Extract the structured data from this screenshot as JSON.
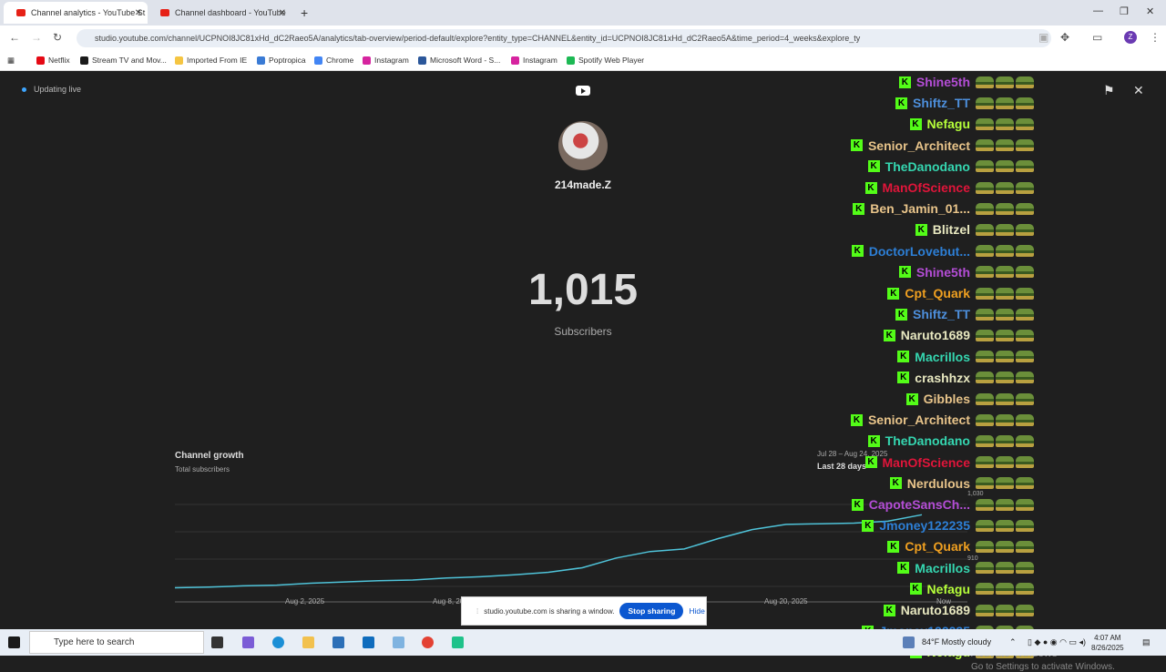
{
  "browser": {
    "tabs": [
      {
        "label": "Channel analytics - YouTube St"
      },
      {
        "label": "Channel dashboard - YouTube"
      }
    ],
    "url": "studio.youtube.com/channel/UCPNOI8JC81xHd_dC2Raeo5A/analytics/tab-overview/period-default/explore?entity_type=CHANNEL&entity_id=UCPNOI8JC81xHd_dC2Raeo5A&time_period=4_weeks&explore_ty",
    "profile_initial": "Z",
    "bookmarks": [
      {
        "label": "Netflix",
        "color": "#e50914"
      },
      {
        "label": "Stream TV and Mov...",
        "color": "#1a1a1a"
      },
      {
        "label": "Imported From IE",
        "color": "#f5c542"
      },
      {
        "label": "Poptropica",
        "color": "#3a7bd5"
      },
      {
        "label": "Chrome",
        "color": "#4285f4"
      },
      {
        "label": "Instagram",
        "color": "#d6249f"
      },
      {
        "label": "Microsoft Word - S...",
        "color": "#2b579a"
      },
      {
        "label": "Instagram",
        "color": "#d6249f"
      },
      {
        "label": "Spotify Web Player",
        "color": "#1db954"
      }
    ]
  },
  "stage": {
    "live_label": "Updating live",
    "channel_name": "214made.Z",
    "subscriber_count": "1,015",
    "subscriber_label": "Subscribers",
    "growth_title": "Channel growth",
    "growth_subtitle": "Total subscribers",
    "range_dates": "Jul 28 – Aug 24, 2025",
    "range_label": "Last 28 days"
  },
  "chart_data": {
    "type": "line",
    "x_tick_labels": [
      "Aug 2, 2025",
      "Aug 8, 2025",
      "Aug 20, 2025",
      "Now"
    ],
    "y_labels": [
      "1,030",
      "910"
    ],
    "values": [
      902,
      903,
      905,
      906,
      909,
      911,
      913,
      914,
      917,
      919,
      922,
      926,
      933,
      948,
      958,
      962,
      978,
      992,
      1000,
      1001,
      1002,
      1005,
      1015
    ]
  },
  "chat": {
    "rows": [
      {
        "name": "Shine5th",
        "color": "#b44dd6"
      },
      {
        "name": "Shiftz_TT",
        "color": "#4d8fdc"
      },
      {
        "name": "Nefagu",
        "color": "#b6ff3a"
      },
      {
        "name": "Senior_Architect",
        "color": "#e8c48a"
      },
      {
        "name": "TheDanodano",
        "color": "#35d6b0"
      },
      {
        "name": "ManOfScience",
        "color": "#e0153a"
      },
      {
        "name": "Ben_Jamin_01...",
        "color": "#e8c48a"
      },
      {
        "name": "Blitzel",
        "color": "#e8e8c0"
      },
      {
        "name": "DoctorLovebut...",
        "color": "#2d7fd6"
      },
      {
        "name": "Shine5th",
        "color": "#b44dd6"
      },
      {
        "name": "Cpt_Quark",
        "color": "#f0a020"
      },
      {
        "name": "Shiftz_TT",
        "color": "#4d8fdc"
      },
      {
        "name": "Naruto1689",
        "color": "#e8e8c0"
      },
      {
        "name": "Macrillos",
        "color": "#35d6b0"
      },
      {
        "name": "crashhzx",
        "color": "#e8e8c0"
      },
      {
        "name": "Gibbles",
        "color": "#e8c48a"
      },
      {
        "name": "Senior_Architect",
        "color": "#e8c48a"
      },
      {
        "name": "TheDanodano",
        "color": "#35d6b0"
      },
      {
        "name": "ManOfScience",
        "color": "#e0153a"
      },
      {
        "name": "Nerdulous",
        "color": "#e8c48a"
      },
      {
        "name": "CapoteSansCh...",
        "color": "#b44dd6"
      },
      {
        "name": "Jmoney122235",
        "color": "#2d7fd6"
      },
      {
        "name": "Cpt_Quark",
        "color": "#f0a020"
      },
      {
        "name": "Macrillos",
        "color": "#35d6b0"
      },
      {
        "name": "Nefagu",
        "color": "#b6ff3a"
      },
      {
        "name": "Naruto1689",
        "color": "#e8e8c0"
      },
      {
        "name": "Jmoney122235",
        "color": "#2d7fd6"
      },
      {
        "name": "Nefagu",
        "color": "#b6ff3a"
      }
    ],
    "badge_letter": "K"
  },
  "windows_notice": {
    "line1": "Activate Windows",
    "line2": "Go to Settings to activate Windows."
  },
  "sharing_bar": {
    "message": "studio.youtube.com is sharing a window.",
    "stop_label": "Stop sharing",
    "hide_label": "Hide"
  },
  "taskbar": {
    "search_placeholder": "Type here to search",
    "weather": "84°F  Mostly cloudy",
    "time": "4:07 AM",
    "date": "8/26/2025"
  }
}
